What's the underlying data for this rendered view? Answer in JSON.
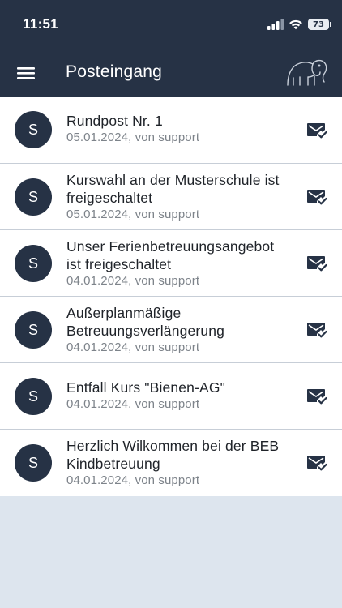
{
  "status_bar": {
    "time": "11:51",
    "battery": "73"
  },
  "header": {
    "title": "Posteingang",
    "menu_icon": "hamburger-menu-icon",
    "logo_icon": "elephant-logo"
  },
  "colors": {
    "header_bg": "#263245",
    "avatar_bg": "#263245",
    "page_bg": "#dde5ee"
  },
  "messages": [
    {
      "avatar": "S",
      "subject": "Rundpost Nr. 1",
      "meta": "05.01.2024, von support"
    },
    {
      "avatar": "S",
      "subject": "Kurswahl an der Musterschule ist freigeschaltet",
      "meta": "05.01.2024, von support"
    },
    {
      "avatar": "S",
      "subject": "Unser Ferienbetreuungsangebot ist freigeschaltet",
      "meta": "04.01.2024, von support"
    },
    {
      "avatar": "S",
      "subject": "Außerplanmäßige Betreuungsverlängerung",
      "meta": "04.01.2024, von support"
    },
    {
      "avatar": "S",
      "subject": "Entfall Kurs \"Bienen-AG\"",
      "meta": "04.01.2024, von support"
    },
    {
      "avatar": "S",
      "subject": "Herzlich Wilkommen bei der BEB Kindbetreuung",
      "meta": "04.01.2024, von support"
    }
  ]
}
